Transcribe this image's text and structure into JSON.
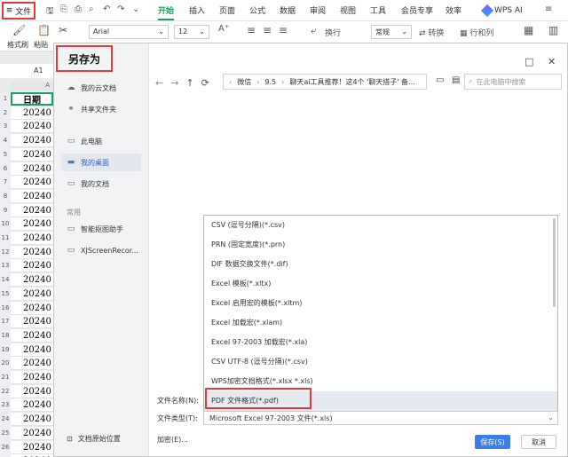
{
  "ribbon": {
    "file_label": "文件",
    "tabs": [
      "开始",
      "插入",
      "页面",
      "公式",
      "数据",
      "审阅",
      "视图",
      "工具",
      "会员专享",
      "效率"
    ],
    "ai_label": "WPS AI",
    "font_name": "Arial",
    "font_size": "12",
    "format_label": "常规",
    "convert_label": "转换",
    "rowcol_label": "行和列",
    "wrap_label": "换行",
    "format_painter_label": "格式刷",
    "paste_label": "粘贴"
  },
  "sheet": {
    "name_box": "A1",
    "col_header": "A",
    "header_cell": "日期",
    "cell_value": "20240",
    "row_numbers": [
      "1",
      "2",
      "3",
      "4",
      "5",
      "6",
      "7",
      "8",
      "9",
      "10",
      "11",
      "12",
      "13",
      "14",
      "15",
      "16",
      "17",
      "18",
      "19",
      "20",
      "21",
      "22",
      "23",
      "24",
      "25",
      "26",
      "27"
    ]
  },
  "dialog": {
    "title": "另存为",
    "nav": [
      {
        "label": "我的云文档"
      },
      {
        "label": "共享文件夹"
      },
      {
        "label": "此电脑"
      },
      {
        "label": "我的桌面"
      },
      {
        "label": "我的文档"
      }
    ],
    "section_label": "常用",
    "nav2": [
      {
        "label": "智能抠图助手"
      },
      {
        "label": "XJScreenRecor..."
      }
    ],
    "bottom_label": "文档原始位置",
    "breadcrumb": [
      "微信",
      "9.5",
      "聊天ai工具推荐！这4个 '聊天搭子' 备..."
    ],
    "search_placeholder": "在此电脑中搜索",
    "file_types": [
      "CSV (逗号分隔)(*.csv)",
      "PRN (固定宽度)(*.prn)",
      "DIF 数据交换文件(*.dif)",
      "Excel 模板(*.xltx)",
      "Excel 启用宏的模板(*.xltm)",
      "Excel 加载宏(*.xlam)",
      "Excel 97-2003 加载宏(*.xla)",
      "CSV UTF-8 (逗号分隔)(*.csv)",
      "WPS加密文档格式(*.xlsx *.xls)",
      "PDF 文件格式(*.pdf)"
    ],
    "filename_label": "文件名称(N):",
    "filetype_label": "文件类型(T):",
    "filetype_value": "Microsoft Excel 97-2003 文件(*.xls)",
    "encrypt_label": "加密(E)...",
    "save_label": "保存(S)",
    "cancel_label": "取消"
  }
}
